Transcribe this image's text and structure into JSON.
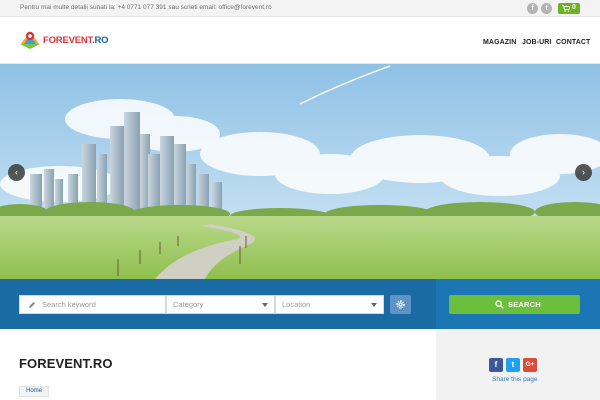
{
  "topbar": {
    "info": "Pentru mai multe detalii sunati la: +4 0771 077 391 sau scrieti email: office@forevent.ro",
    "social": [
      {
        "name": "facebook-icon",
        "glyph": "f"
      },
      {
        "name": "twitter-icon",
        "glyph": "t"
      }
    ],
    "cart_count": "0"
  },
  "header": {
    "logo_main": "FOREVENT",
    "logo_suffix": ".RO",
    "nav": [
      "MAGAZIN",
      "JOB-URI",
      "CONTACT"
    ]
  },
  "hero": {
    "prev": "‹",
    "next": "›"
  },
  "search": {
    "keyword_placeholder": "Search keyword",
    "category_placeholder": "Category",
    "location_placeholder": "Location",
    "button_label": "SEARCH"
  },
  "page": {
    "title": "FOREVENT.RO",
    "breadcrumb": "Home"
  },
  "share": {
    "label": "Share this page",
    "buttons": [
      {
        "glyph": "f",
        "color": "#3b5998"
      },
      {
        "glyph": "t",
        "color": "#1da1f2"
      },
      {
        "glyph": "G+",
        "color": "#dd4b39"
      }
    ]
  },
  "colors": {
    "brand_red": "#d8353b",
    "brand_blue": "#1b5fa5",
    "search_bar": "#1d76b4",
    "search_button": "#6bbf3c"
  }
}
